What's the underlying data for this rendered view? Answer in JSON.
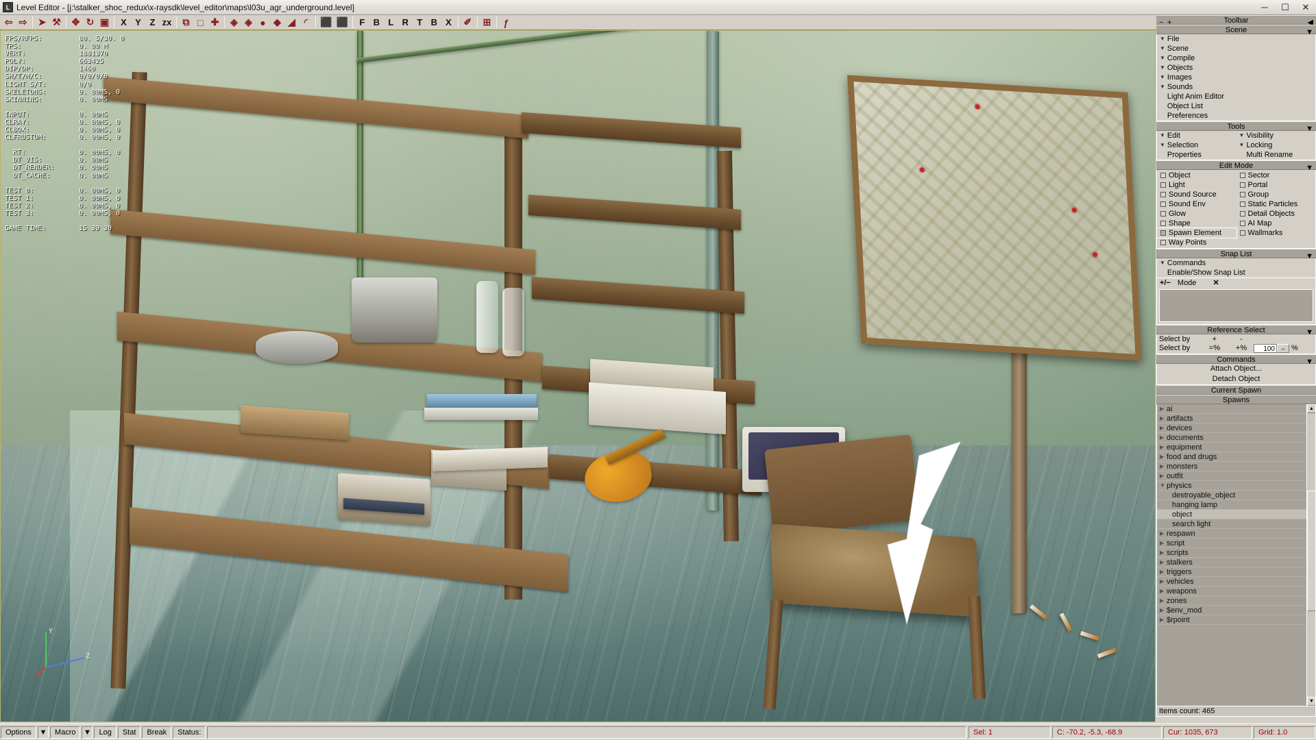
{
  "window": {
    "icon": "app-icon",
    "title": "Level Editor - [j:\\stalker_shoc_redux\\x-raysdk\\level_editor\\maps\\l03u_agr_underground.level]",
    "minimize": "─",
    "maximize": "☐",
    "close": "✕"
  },
  "toolbar": {
    "items": [
      {
        "name": "undo-icon",
        "glyph": "⇦"
      },
      {
        "name": "redo-icon",
        "glyph": "⇨"
      },
      {
        "name": "select-cursor-icon",
        "glyph": "➤"
      },
      {
        "name": "paint-bucket-icon",
        "glyph": "⚒"
      },
      {
        "name": "move-icon",
        "glyph": "✥"
      },
      {
        "name": "rotate-icon",
        "glyph": "↻"
      },
      {
        "name": "scale-icon",
        "glyph": "▣"
      },
      {
        "name": "axis-x-label",
        "glyph": "X"
      },
      {
        "name": "axis-y-label",
        "glyph": "Y"
      },
      {
        "name": "axis-z-label",
        "glyph": "Z"
      },
      {
        "name": "axis-zx-label",
        "glyph": "zx"
      },
      {
        "name": "align-icon",
        "glyph": "⧉"
      },
      {
        "name": "frame-icon",
        "glyph": "□"
      },
      {
        "name": "pivot-icon",
        "glyph": "✚"
      },
      {
        "name": "object-add-icon",
        "glyph": "◈"
      },
      {
        "name": "object-copy-icon",
        "glyph": "◈"
      },
      {
        "name": "sphere-icon",
        "glyph": "●"
      },
      {
        "name": "drop-icon",
        "glyph": "◆"
      },
      {
        "name": "erase-icon",
        "glyph": "◢"
      },
      {
        "name": "link-icon",
        "glyph": "◜"
      },
      {
        "name": "cube-icon",
        "glyph": "⬛"
      },
      {
        "name": "cube-alt-icon",
        "glyph": "⬛"
      },
      {
        "name": "view-front-button",
        "glyph": "F"
      },
      {
        "name": "view-back-button",
        "glyph": "B"
      },
      {
        "name": "view-left-button",
        "glyph": "L"
      },
      {
        "name": "view-right-button",
        "glyph": "R"
      },
      {
        "name": "view-top-button",
        "glyph": "T"
      },
      {
        "name": "view-bottom-button",
        "glyph": "B"
      },
      {
        "name": "view-reset-button",
        "glyph": "X"
      },
      {
        "name": "pen-icon",
        "glyph": "✐"
      },
      {
        "name": "grid-icon",
        "glyph": "⊞"
      },
      {
        "name": "italic-f-icon",
        "glyph": "ƒ"
      }
    ],
    "separators_after": [
      1,
      3,
      6,
      10,
      13,
      19,
      21,
      28,
      29,
      30
    ]
  },
  "stats": {
    "rows": [
      {
        "key": "FPS/RFPS:",
        "value": "80. 5/30. 0"
      },
      {
        "key": "TPS:",
        "value": "0. 00 M"
      },
      {
        "key": "VERT:",
        "value": "1881370"
      },
      {
        "key": "POLY:",
        "value": "663425"
      },
      {
        "key": "DIP/DP:",
        "value": "1460"
      },
      {
        "key": "SH/T/M/C:",
        "value": "0/0/0/0"
      },
      {
        "key": "LIGHT S/T:",
        "value": "0/0"
      },
      {
        "key": "SKELETONS:",
        "value": "0. 00MS, 0"
      },
      {
        "key": "SKINNING:",
        "value": "0. 00MS"
      },
      {
        "key": "",
        "value": ""
      },
      {
        "key": "INPUT:",
        "value": "0. 00MS"
      },
      {
        "key": "CLRAY:",
        "value": "0. 00MS, 0"
      },
      {
        "key": "CLBOX:",
        "value": "0. 00MS, 0"
      },
      {
        "key": "CLFRUSTUM:",
        "value": "0. 00MS, 0"
      },
      {
        "key": "",
        "value": ""
      },
      {
        "key": "  RT:",
        "value": "0. 00MS, 0"
      },
      {
        "key": "  DT_VIS:",
        "value": "0. 00MS"
      },
      {
        "key": "  DT_RENDER:",
        "value": "0. 00MS"
      },
      {
        "key": "  DT_CACHE:",
        "value": "0. 00MS"
      },
      {
        "key": "",
        "value": ""
      },
      {
        "key": "TEST 0:",
        "value": "0. 00MS, 0"
      },
      {
        "key": "TEST 1:",
        "value": "0. 00MS, 0"
      },
      {
        "key": "TEST 2:",
        "value": "0. 00MS, 0"
      },
      {
        "key": "TEST 3:",
        "value": "0. 00MS, 0"
      },
      {
        "key": "",
        "value": ""
      },
      {
        "key": "GAME TIME:",
        "value": "15 39 30"
      }
    ]
  },
  "dock": {
    "toolbar_header": {
      "title": "Toolbar",
      "minus": "−",
      "plus": "+",
      "collapse": "◀"
    },
    "scene": {
      "title": "Scene",
      "items": [
        {
          "label": "File",
          "expandable": true
        },
        {
          "label": "Scene",
          "expandable": true
        },
        {
          "label": "Compile",
          "expandable": true
        },
        {
          "label": "Objects",
          "expandable": true
        },
        {
          "label": "Images",
          "expandable": true
        },
        {
          "label": "Sounds",
          "expandable": true
        },
        {
          "label": "Light Anim Editor",
          "expandable": false
        },
        {
          "label": "Object List",
          "expandable": false
        },
        {
          "label": "Preferences",
          "expandable": false
        }
      ]
    },
    "tools": {
      "title": "Tools",
      "rows": [
        [
          {
            "label": "Edit",
            "expandable": true
          },
          {
            "label": "Visibility",
            "expandable": true
          }
        ],
        [
          {
            "label": "Selection",
            "expandable": true
          },
          {
            "label": "Locking",
            "expandable": true
          }
        ],
        [
          {
            "label": "Properties",
            "expandable": false
          },
          {
            "label": "Multi Rename",
            "expandable": false
          }
        ]
      ]
    },
    "edit_mode": {
      "title": "Edit Mode",
      "items": [
        {
          "label": "Object",
          "checked": false
        },
        {
          "label": "Sector",
          "checked": false
        },
        {
          "label": "Light",
          "checked": false
        },
        {
          "label": "Portal",
          "checked": false
        },
        {
          "label": "Sound Source",
          "checked": false
        },
        {
          "label": "Group",
          "checked": false
        },
        {
          "label": "Sound Env",
          "checked": false
        },
        {
          "label": "Static Particles",
          "checked": false
        },
        {
          "label": "Glow",
          "checked": false
        },
        {
          "label": "Detail Objects",
          "checked": false
        },
        {
          "label": "Shape",
          "checked": false
        },
        {
          "label": "AI Map",
          "checked": false
        },
        {
          "label": "Spawn Element",
          "checked": true,
          "selected": true
        },
        {
          "label": "Wallmarks",
          "checked": false
        },
        {
          "label": "Way Points",
          "checked": false
        }
      ]
    },
    "snap_list": {
      "title": "Snap List",
      "commands_label": "Commands",
      "enable_label": "Enable/Show Snap List",
      "mode_label": "Mode",
      "mode_prefix": "+/−",
      "clear_glyph": "✕"
    },
    "reference_select": {
      "title": "Reference Select",
      "row1": {
        "label": "Select by",
        "plus": "+",
        "minus": "-"
      },
      "row2": {
        "label": "Select by",
        "eq": "=%",
        "plus": "+%",
        "value": "100",
        "unit": "%",
        "spin": "↔"
      }
    },
    "commands": {
      "title": "Commands",
      "attach": "Attach Object...",
      "detach": "Detach Object"
    },
    "current_spawn": {
      "title": "Current Spawn"
    },
    "spawns": {
      "title": "Spawns",
      "nodes": [
        {
          "label": "ai",
          "level": 1,
          "expanded": false
        },
        {
          "label": "artifacts",
          "level": 1,
          "expanded": false
        },
        {
          "label": "devices",
          "level": 1,
          "expanded": false
        },
        {
          "label": "documents",
          "level": 1,
          "expanded": false
        },
        {
          "label": "equipment",
          "level": 1,
          "expanded": false
        },
        {
          "label": "food and drugs",
          "level": 1,
          "expanded": false
        },
        {
          "label": "monsters",
          "level": 1,
          "expanded": false
        },
        {
          "label": "outfit",
          "level": 1,
          "expanded": false
        },
        {
          "label": "physics",
          "level": 1,
          "expanded": true
        },
        {
          "label": "destroyable_object",
          "level": 2
        },
        {
          "label": "hanging lamp",
          "level": 2
        },
        {
          "label": "object",
          "level": 2,
          "selected": true
        },
        {
          "label": "search light",
          "level": 2
        },
        {
          "label": "respawn",
          "level": 1,
          "expanded": false
        },
        {
          "label": "script",
          "level": 1,
          "expanded": false
        },
        {
          "label": "scripts",
          "level": 1,
          "expanded": false
        },
        {
          "label": "stalkers",
          "level": 1,
          "expanded": false
        },
        {
          "label": "triggers",
          "level": 1,
          "expanded": false
        },
        {
          "label": "vehicles",
          "level": 1,
          "expanded": false
        },
        {
          "label": "weapons",
          "level": 1,
          "expanded": false
        },
        {
          "label": "zones",
          "level": 1,
          "expanded": false
        },
        {
          "label": "$env_mod",
          "level": 1,
          "expanded": false
        },
        {
          "label": "$rpoint",
          "level": 1,
          "expanded": false
        }
      ]
    },
    "items_count": "Items count: 465"
  },
  "statusbar": {
    "options": "Options",
    "options_drop": "▼",
    "macro": "Macro",
    "macro_drop": "▼",
    "log": "Log",
    "stat": "Stat",
    "break": "Break",
    "status_label": "Status:",
    "status_value": "",
    "sel": "Sel: 1",
    "coords": "C: -70.2, -5.3, -68.9",
    "cursor": "Cur: 1035, 673",
    "grid": "Grid: 1.0"
  },
  "colors": {
    "chrome": "#d4d0c8",
    "panel_header": "#a6a29a",
    "status_red": "#a10000",
    "viewport_border": "#b9b268",
    "tree_bg": "#a6a29a"
  }
}
